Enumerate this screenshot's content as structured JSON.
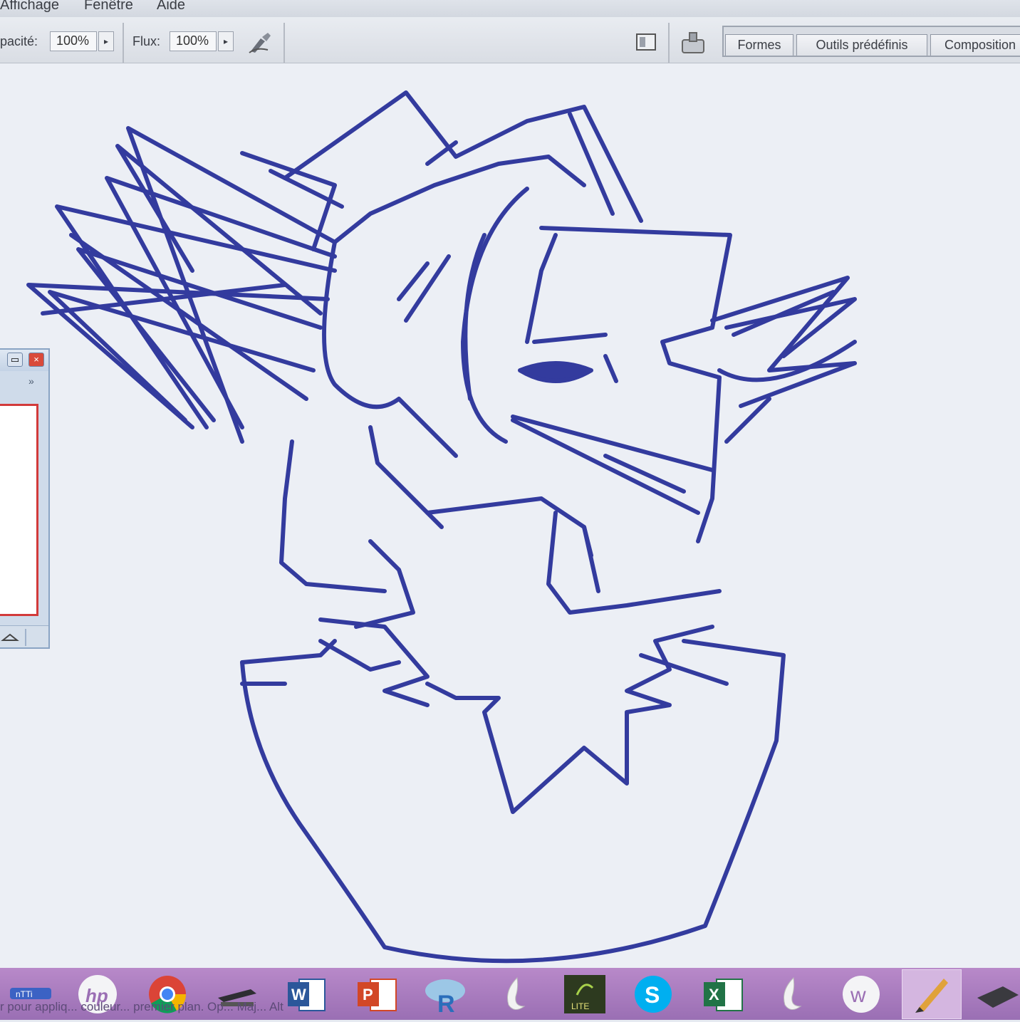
{
  "menu": {
    "items": [
      "Affichage",
      "Fenêtre",
      "Aide"
    ]
  },
  "options": {
    "opacity_label": "pacité:",
    "opacity_value": "100%",
    "flow_label": "Flux:",
    "flow_value": "100%"
  },
  "panel_tabs": [
    "Formes",
    "Outils prédéfinis",
    "Composition"
  ],
  "floating_panel": {
    "expand_glyph": "»"
  },
  "taskbar": {
    "status_text": "r pour appliq... couleur... premier plan. Op... Maj... Alt",
    "apps": [
      {
        "name": "intel-graphics-icon"
      },
      {
        "name": "hp-icon",
        "label": "hp"
      },
      {
        "name": "chrome-icon"
      },
      {
        "name": "scanner-icon"
      },
      {
        "name": "word-icon",
        "label": "W"
      },
      {
        "name": "powerpoint-icon",
        "label": "P"
      },
      {
        "name": "r-project-icon",
        "label": "R"
      },
      {
        "name": "dragon-icon"
      },
      {
        "name": "lite-app-icon",
        "label": "LITE"
      },
      {
        "name": "skype-icon",
        "label": "S"
      },
      {
        "name": "excel-icon",
        "label": "X"
      },
      {
        "name": "dragon-icon-2"
      },
      {
        "name": "w-app-icon",
        "label": "w"
      },
      {
        "name": "paint-brush-app-icon"
      },
      {
        "name": "tablet-icon"
      }
    ]
  },
  "colors": {
    "ink": "#333b9e",
    "taskbar": "#a97bc0"
  }
}
